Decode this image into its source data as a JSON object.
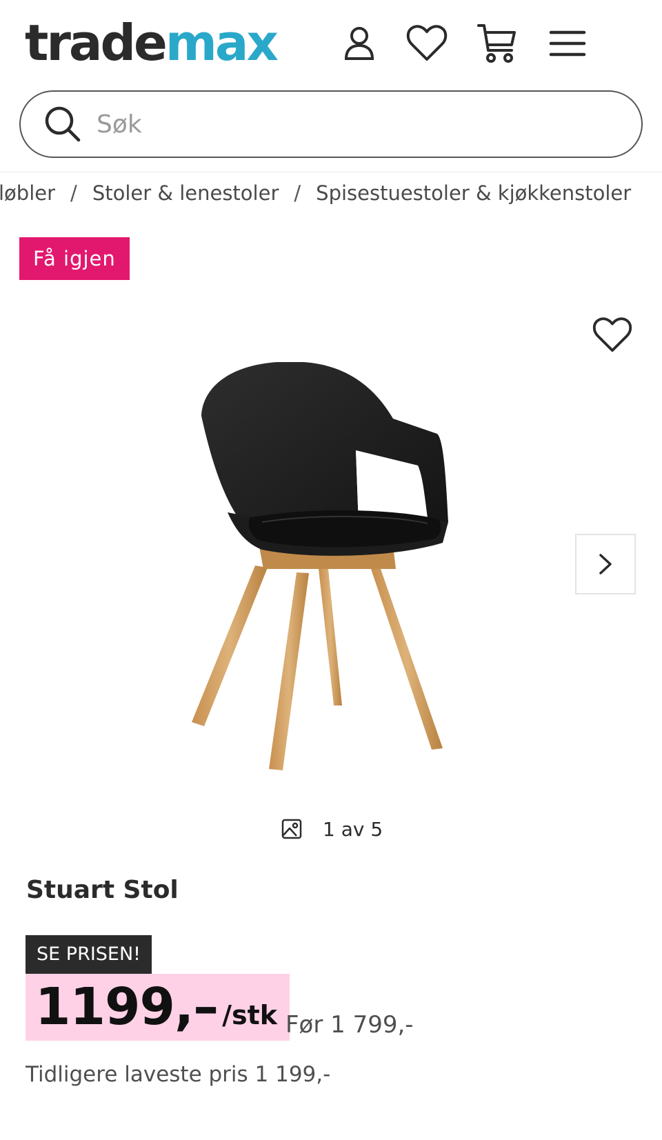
{
  "header": {
    "logo_part1": "trade",
    "logo_part2": "max",
    "brand_color": "#2aa8c9"
  },
  "search": {
    "placeholder": "Søk"
  },
  "breadcrumb": {
    "items": [
      "løbler",
      "Stoler & lenestoler",
      "Spisestuestoler & kjøkkenstoler"
    ],
    "separator": "/"
  },
  "promo": {
    "badge": "Få igjen",
    "badge_color": "#e2186e"
  },
  "gallery": {
    "counter": "1 av 5"
  },
  "product": {
    "title": "Stuart Stol",
    "deal_label": "SE PRISEN!",
    "price": "1199,–",
    "price_unit": "/stk",
    "price_before": "Før 1 799,-",
    "lowest_price": "Tidligere laveste pris 1 199,-",
    "price_highlight_color": "#ffd1e6"
  },
  "icons": {
    "account": "user-icon",
    "wishlist": "heart-icon",
    "cart": "cart-icon",
    "menu": "menu-icon",
    "search": "search-icon",
    "next": "chevron-right-icon",
    "gallery": "image-icon"
  }
}
